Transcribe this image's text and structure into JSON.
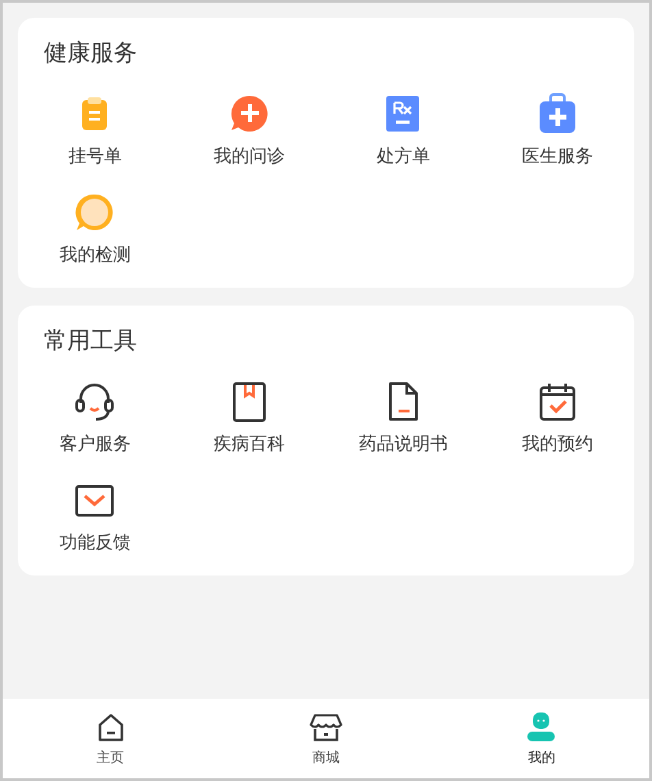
{
  "sections": [
    {
      "title": "健康服务",
      "items": [
        {
          "label": "挂号单",
          "kind": "clipboard"
        },
        {
          "label": "我的问诊",
          "kind": "consult"
        },
        {
          "label": "处方单",
          "kind": "rx"
        },
        {
          "label": "医生服务",
          "kind": "medkit"
        },
        {
          "label": "我的检测",
          "kind": "bubble"
        }
      ]
    },
    {
      "title": "常用工具",
      "items": [
        {
          "label": "客户服务",
          "kind": "headset"
        },
        {
          "label": "疾病百科",
          "kind": "book"
        },
        {
          "label": "药品说明书",
          "kind": "document"
        },
        {
          "label": "我的预约",
          "kind": "calendar"
        },
        {
          "label": "功能反馈",
          "kind": "mail"
        }
      ]
    }
  ],
  "tabs": [
    {
      "label": "主页",
      "kind": "home",
      "selected": false
    },
    {
      "label": "商城",
      "kind": "shop",
      "selected": false
    },
    {
      "label": "我的",
      "kind": "profile",
      "selected": true
    }
  ]
}
